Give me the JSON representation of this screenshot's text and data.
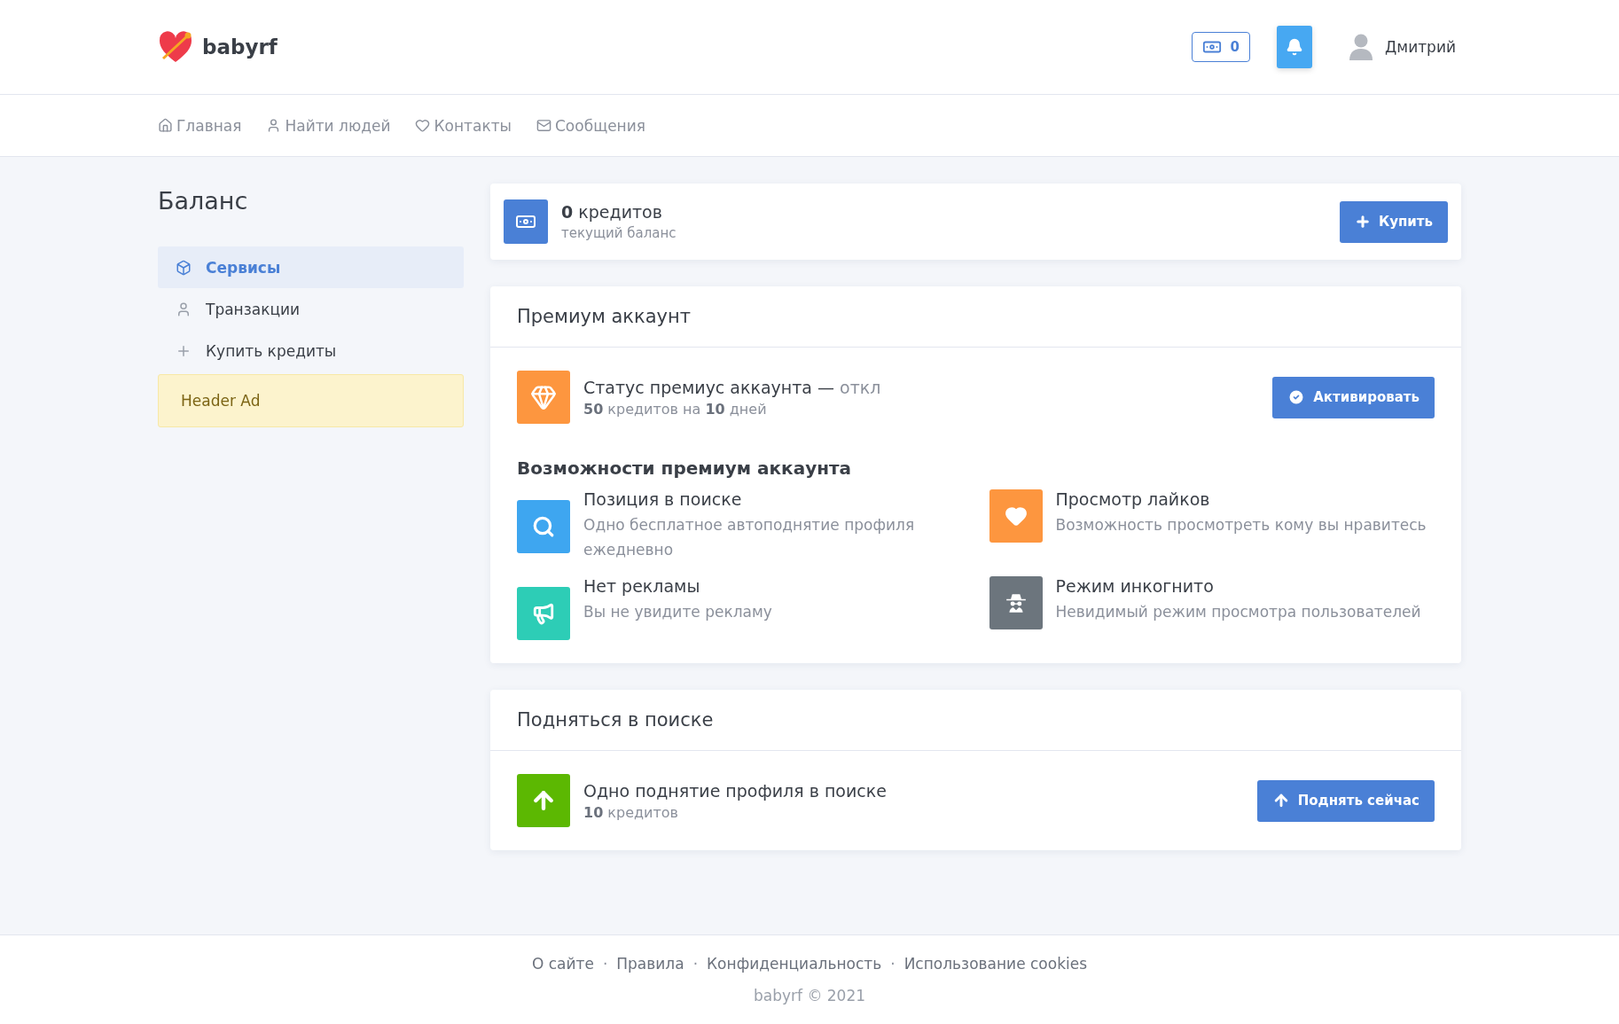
{
  "header": {
    "logo": "babyrf",
    "credits": "0",
    "user": "Дмитрий"
  },
  "nav": [
    {
      "label": "Главная"
    },
    {
      "label": "Найти людей"
    },
    {
      "label": "Контакты"
    },
    {
      "label": "Сообщения"
    }
  ],
  "page_title": "Баланс",
  "sidebar": {
    "items": [
      {
        "label": "Сервисы",
        "selected": true
      },
      {
        "label": "Транзакции",
        "selected": false
      },
      {
        "label": "Купить кредиты",
        "selected": false
      }
    ],
    "ad": "Header Ad"
  },
  "balance": {
    "amount": "0",
    "unit": "кредитов",
    "caption": "текущий баланс",
    "button": "Купить"
  },
  "premium": {
    "title": "Премиум аккаунт",
    "status_title": "Статус премиус аккаунта —",
    "status": "откл",
    "price": "**50** кредитов на **10** дней",
    "button": "Активировать",
    "features_title": "Возможности премиум аккаунта",
    "features": [
      {
        "color": "#3ea6f0",
        "title": "Позиция в поиске",
        "text": "Одно бесплатное автоподнятие профиля ежедневно"
      },
      {
        "color": "#fd963f",
        "title": "Просмотр лайков",
        "text": "Возможность просмотреть кому вы нравитесь"
      },
      {
        "color": "#2dcdb6",
        "title": "Нет рекламы",
        "text": "Вы не увидите рекламу"
      },
      {
        "color": "#6c757d",
        "title": "Режим инкогнито",
        "text": "Невидимый режим просмотра пользователей"
      }
    ]
  },
  "boost": {
    "title": "Подняться в поиске",
    "item_title": "Одно поднятие профиля в поиске",
    "price": "**10** кредитов",
    "button": "Поднять сейчас"
  },
  "footer": {
    "links": [
      "О сайте",
      "Правила",
      "Конфиденциальность",
      "Использование cookies"
    ],
    "separator": "·",
    "copyright": "babyrf © 2021"
  }
}
